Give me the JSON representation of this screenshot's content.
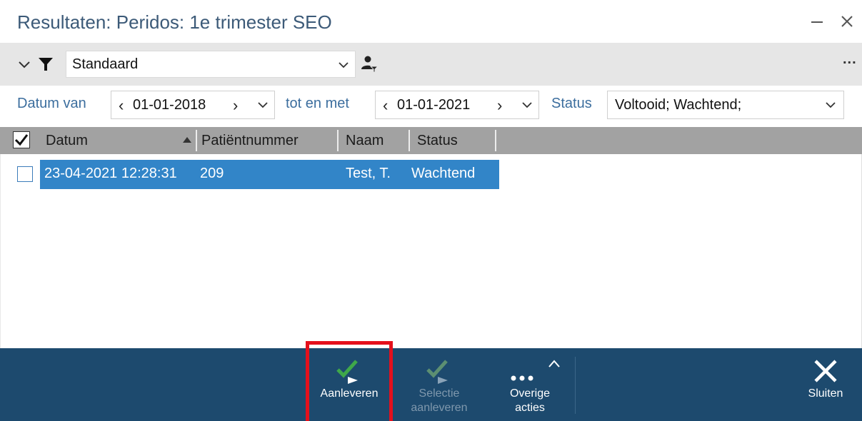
{
  "window": {
    "title": "Resultaten: Peridos: 1e trimester SEO",
    "minimize_icon": "minimize-icon",
    "close_icon": "close-icon"
  },
  "filter": {
    "profile_value": "Standaard",
    "more_label": "...",
    "icons": [
      "chevron-down-icon",
      "funnel-icon",
      "person-filter-icon"
    ]
  },
  "criteria": {
    "date_from_label": "Datum van",
    "date_from_value": "01-01-2018",
    "date_to_label": "tot en met",
    "date_to_value": "01-01-2021",
    "status_label": "Status",
    "status_value": "Voltooid; Wachtend;"
  },
  "grid": {
    "columns": [
      "Datum",
      "Patiëntnummer",
      "Naam",
      "Status"
    ],
    "sort_column": "Datum",
    "sort_direction": "ascending",
    "rows": [
      {
        "checked": false,
        "selected": true,
        "datum": "23-04-2021 12:28:31",
        "patientnummer": "209",
        "naam": "Test, T.",
        "status": "Wachtend"
      }
    ]
  },
  "footer": {
    "aanleveren_label": "Aanleveren",
    "selectie_label_line1": "Selectie",
    "selectie_label_line2": "aanleveren",
    "overige_label_line1": "Overige",
    "overige_label_line2": "acties",
    "sluiten_label": "Sluiten"
  },
  "colors": {
    "title_text": "#3c5a78",
    "label_blue": "#3c6e9e",
    "selected_row": "#3285c8",
    "footer_bg": "#1d4a6e",
    "highlight": "#e4101c",
    "check_green": "#3fa84a"
  }
}
